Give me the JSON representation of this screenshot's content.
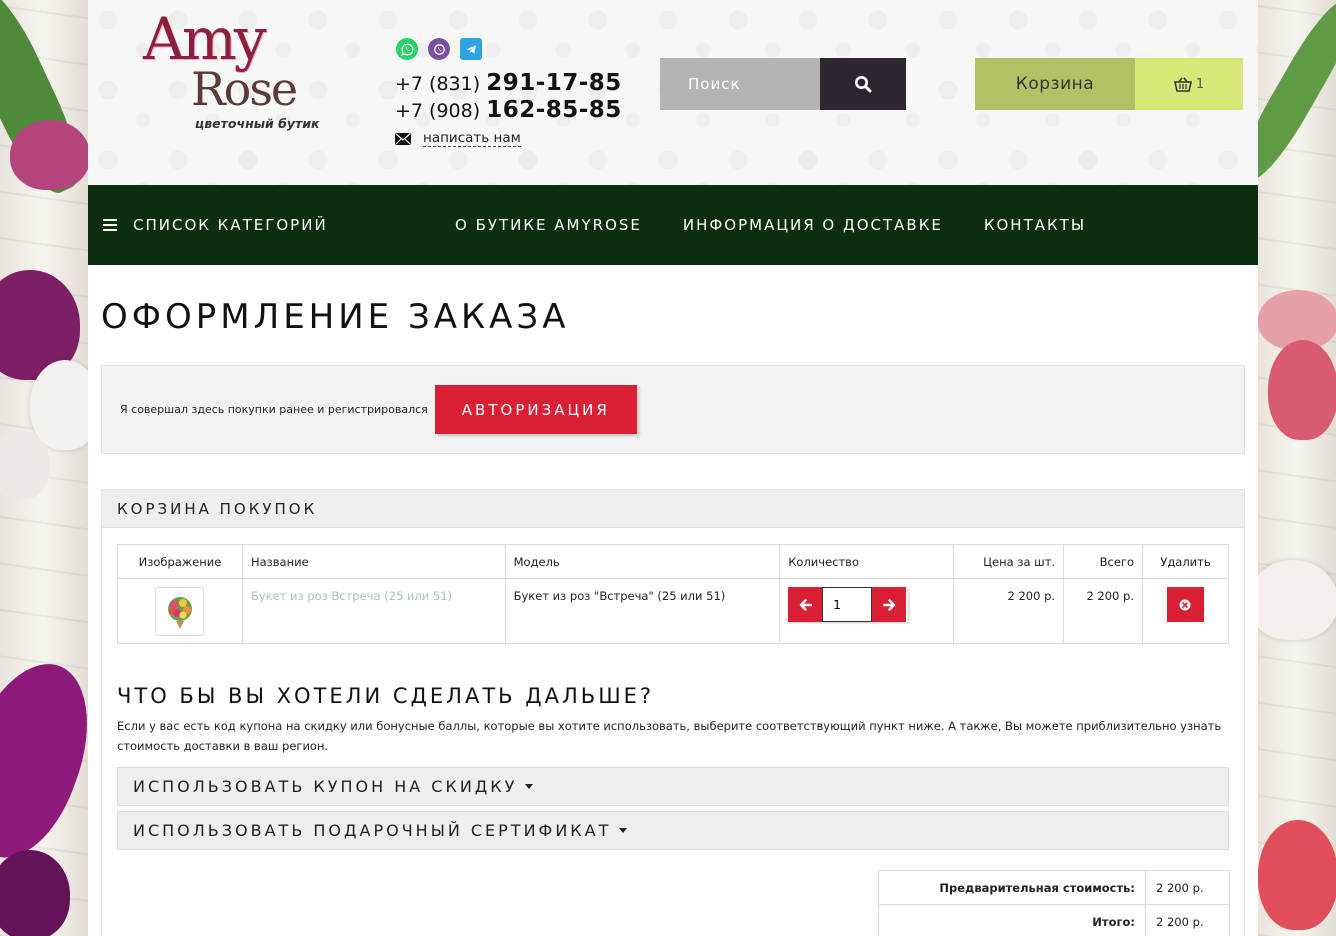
{
  "header": {
    "logo": {
      "line1": "Amy",
      "line2": "Rose",
      "tagline": "цветочный бутик"
    },
    "messengers": [
      {
        "icon": "whatsapp-icon",
        "color": "#25d366"
      },
      {
        "icon": "viber-icon",
        "color": "#7b519d"
      },
      {
        "icon": "telegram-icon",
        "color": "#2ca5e0"
      }
    ],
    "phones": [
      {
        "code": "+7 (831)",
        "number": "291-17-85"
      },
      {
        "code": "+7 (908)",
        "number": "162-85-85"
      }
    ],
    "write_us": "написать нам",
    "search": {
      "placeholder": "Поиск"
    },
    "cart": {
      "label": "Корзина",
      "count": "1"
    }
  },
  "nav": {
    "categories": "СПИСОК КАТЕГОРИЙ",
    "links": [
      "О БУТИКЕ AMYROSE",
      "ИНФОРМАЦИЯ О ДОСТАВКЕ",
      "КОНТАКТЫ"
    ]
  },
  "page": {
    "title": "ОФОРМЛЕНИЕ ЗАКАЗА",
    "login_text": "Я совершал здесь покупки ранее и регистрировался",
    "auth_button": "АВТОРИЗАЦИЯ"
  },
  "cart_panel": {
    "title": "КОРЗИНА ПОКУПОК",
    "columns": [
      "Изображение",
      "Название",
      "Модель",
      "Количество",
      "Цена за шт.",
      "Всего",
      "Удалить"
    ],
    "rows": [
      {
        "name": "Букет из роз Встреча (25 или 51)",
        "model": "Букет из роз \"Встреча\" (25 или 51)",
        "quantity": "1",
        "price": "2 200 р.",
        "total": "2 200 р."
      }
    ]
  },
  "next": {
    "title": "ЧТО БЫ ВЫ ХОТЕЛИ СДЕЛАТЬ ДАЛЬШЕ?",
    "text": "Если у вас есть код купона на скидку или бонусные баллы, которые вы хотите использовать, выберите соответствующий пункт ниже. А также, Вы можете приблизительно узнать стоимость доставки в ваш регион.",
    "coupon": "ИСПОЛЬЗОВАТЬ КУПОН НА СКИДКУ",
    "voucher": "ИСПОЛЬЗОВАТЬ ПОДАРОЧНЫЙ СЕРТИФИКАТ"
  },
  "totals": [
    {
      "label": "Предварительная стоимость:",
      "value": "2 200 р."
    },
    {
      "label": "Итого:",
      "value": "2 200 р."
    }
  ],
  "colors": {
    "accent_red": "#d91f33",
    "nav_green": "#0e2e10",
    "cart_green": "#b5c065",
    "cart_count_green": "#d9e779",
    "search_dark": "#2d2530"
  }
}
